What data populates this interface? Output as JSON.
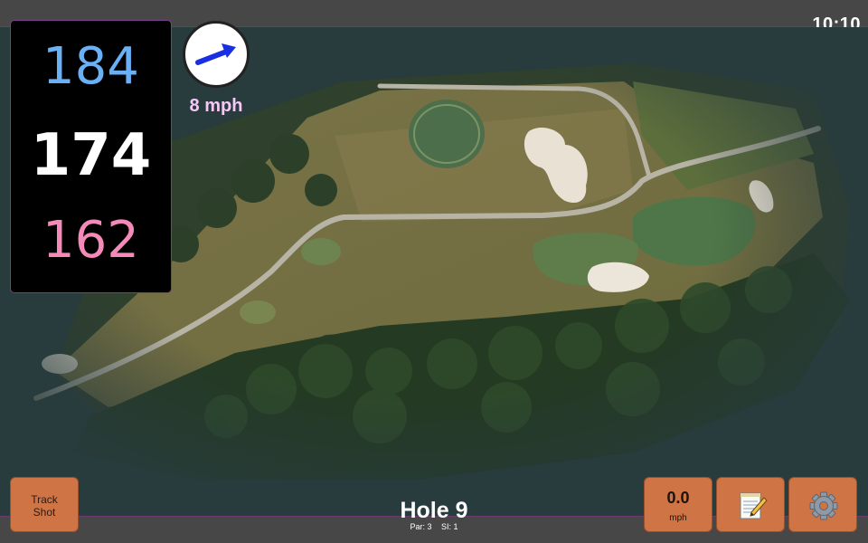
{
  "status_bar": {
    "time": "10:10"
  },
  "distances": {
    "back": "184",
    "middle": "174",
    "front": "162"
  },
  "wind": {
    "speed": "8 mph",
    "arrow_icon": "wind-direction-arrow-icon"
  },
  "hole": {
    "title": "Hole 9",
    "par": "Par: 3",
    "stroke_index": "SI: 1"
  },
  "buttons": {
    "track_shot": {
      "line1": "Track",
      "line2": "Shot"
    },
    "speed": {
      "value": "0.0",
      "unit": "mph"
    },
    "notes": {
      "icon": "notepad-icon"
    },
    "settings": {
      "icon": "gear-icon"
    }
  },
  "colors": {
    "back_distance": "#6ab0f5",
    "middle_distance": "#ffffff",
    "front_distance": "#f58ab8",
    "wind_text": "#f6c8f5",
    "button_bg": "#cf7445",
    "accent_border": "#7a3f8a"
  },
  "map": {
    "type": "aerial-satellite-hole-view"
  }
}
